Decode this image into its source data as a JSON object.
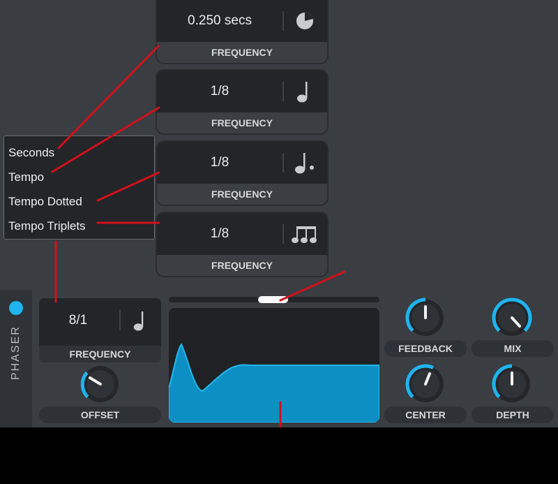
{
  "frequency_cards": [
    {
      "value": "0.250 secs",
      "label": "FREQUENCY",
      "icon": "clock-icon"
    },
    {
      "value": "1/8",
      "label": "FREQUENCY",
      "icon": "quarter-note-icon"
    },
    {
      "value": "1/8",
      "label": "FREQUENCY",
      "icon": "dotted-note-icon"
    },
    {
      "value": "1/8",
      "label": "FREQUENCY",
      "icon": "triplet-notes-icon"
    }
  ],
  "menu": {
    "items": [
      "Seconds",
      "Tempo",
      "Tempo Dotted",
      "Tempo Triplets"
    ]
  },
  "panel": {
    "title": "PHASER",
    "frequency": {
      "value": "8/1",
      "label": "FREQUENCY",
      "icon": "quarter-note-icon"
    },
    "knobs": {
      "offset": "OFFSET",
      "feedback": "FEEDBACK",
      "mix": "MIX",
      "center": "CENTER",
      "depth": "DEPTH"
    }
  },
  "colors": {
    "accent": "#1fb4ee",
    "graph_fill": "#0e8fc3",
    "annotation_line": "#d1101a",
    "panel_bg": "#3a3d42"
  }
}
